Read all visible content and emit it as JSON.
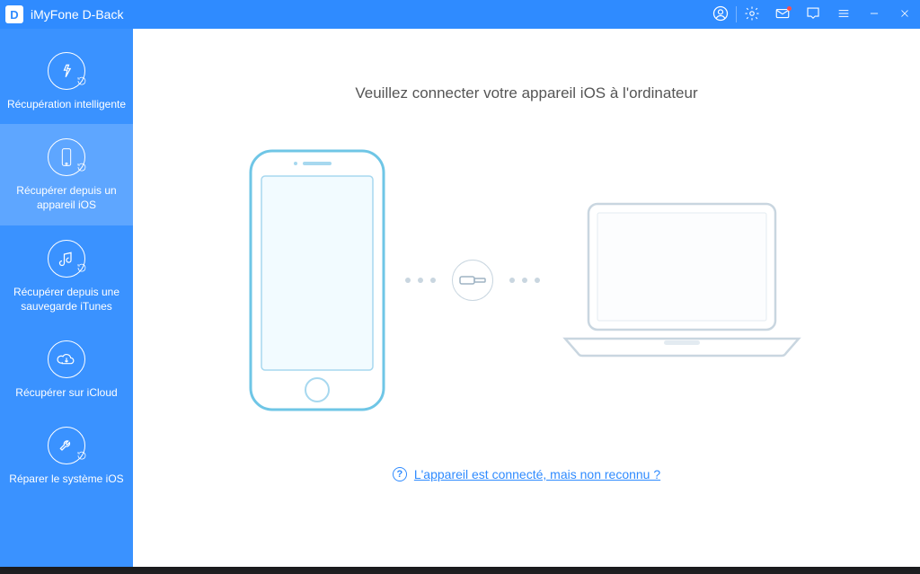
{
  "app": {
    "title": "iMyFone D-Back",
    "logo_letter": "D"
  },
  "sidebar": {
    "items": [
      {
        "label": "Récupération intelligente"
      },
      {
        "label": "Récupérer depuis un appareil iOS"
      },
      {
        "label": "Récupérer depuis une sauvegarde iTunes"
      },
      {
        "label": "Récupérer sur iCloud"
      },
      {
        "label": "Réparer le système iOS"
      }
    ],
    "active_index": 1
  },
  "main": {
    "instruction": "Veuillez connecter votre appareil iOS à l'ordinateur",
    "help_link": "L'appareil est connecté, mais non reconnu ?",
    "help_glyph": "?"
  },
  "colors": {
    "primary": "#2f8bff",
    "sidebar": "#3a92ff",
    "sidebar_active": "#5ea6ff",
    "outline_light": "#a7d8ef",
    "outline_grey": "#c9d6e0"
  }
}
